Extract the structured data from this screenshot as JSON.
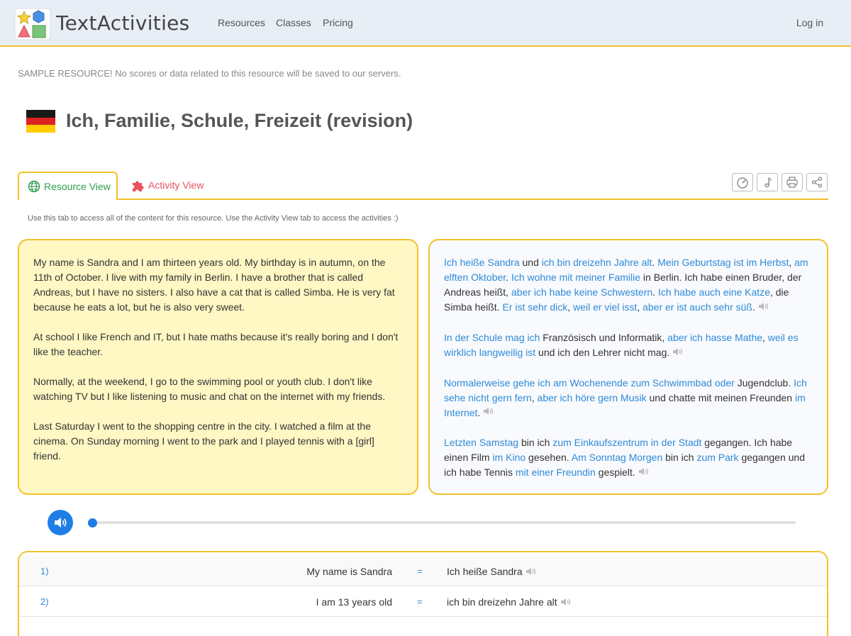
{
  "header": {
    "brand": "TextActivities",
    "nav": [
      "Resources",
      "Classes",
      "Pricing"
    ],
    "login": "Log in"
  },
  "sample_note": "SAMPLE RESOURCE! No scores or data related to this resource will be saved to our servers.",
  "page_title": "Ich, Familie, Schule, Freizeit (revision)",
  "tabs": {
    "resource": "Resource View",
    "activity": "Activity View"
  },
  "hint": "Use this tab to access all of the content for this resource. Use the Activity View tab to access the activities :)",
  "english": [
    "My name is Sandra and I am thirteen years old. My birthday is in autumn, on the 11th of October. I live with my family in Berlin. I have a brother that is called Andreas, but I have no sisters. I also have a cat that is called Simba. He is very fat because he eats a lot, but he is also very sweet.",
    "At school I like French and IT, but I hate maths because it's really boring and I don't like the teacher.",
    "Normally, at the weekend, I go to the swimming pool or youth club. I don't like watching TV but I like listening to music and chat on the internet with my friends.",
    "Last Saturday I went to the shopping centre in the city. I watched a film at the cinema. On Sunday morning I went to the park and I played tennis with a [girl] friend."
  ],
  "german": [
    [
      {
        "t": "Ich heiße Sandra",
        "b": true
      },
      {
        "t": " und ",
        "b": false
      },
      {
        "t": "ich bin dreizehn Jahre alt",
        "b": true
      },
      {
        "t": ". ",
        "b": false
      },
      {
        "t": "Mein Geburtstag ist im Herbst",
        "b": true
      },
      {
        "t": ", ",
        "b": false
      },
      {
        "t": "am elften Oktober",
        "b": true
      },
      {
        "t": ". ",
        "b": false
      },
      {
        "t": "Ich wohne mit meiner Familie",
        "b": true
      },
      {
        "t": " in Berlin. Ich habe einen Bruder, der Andreas heißt, ",
        "b": false
      },
      {
        "t": "aber ich habe keine Schwestern",
        "b": true
      },
      {
        "t": ". ",
        "b": false
      },
      {
        "t": "Ich habe auch eine Katze",
        "b": true
      },
      {
        "t": ", die Simba heißt. ",
        "b": false
      },
      {
        "t": "Er ist sehr dick",
        "b": true
      },
      {
        "t": ", ",
        "b": false
      },
      {
        "t": "weil er viel isst",
        "b": true
      },
      {
        "t": ", ",
        "b": false
      },
      {
        "t": "aber er ist auch sehr süß",
        "b": true
      },
      {
        "t": ".",
        "b": false
      }
    ],
    [
      {
        "t": "In der Schule mag ich",
        "b": true
      },
      {
        "t": " Französisch und Informatik, ",
        "b": false
      },
      {
        "t": "aber ich hasse Mathe",
        "b": true
      },
      {
        "t": ", ",
        "b": false
      },
      {
        "t": "weil es wirklich langweilig ist",
        "b": true
      },
      {
        "t": " und ich den Lehrer nicht mag.",
        "b": false
      }
    ],
    [
      {
        "t": "Normalerweise gehe ich am Wochenende zum Schwimmbad oder",
        "b": true
      },
      {
        "t": " Jugendclub. ",
        "b": false
      },
      {
        "t": "Ich sehe nicht gern fern",
        "b": true
      },
      {
        "t": ", ",
        "b": false
      },
      {
        "t": "aber ich höre gern Musik",
        "b": true
      },
      {
        "t": " und chatte mit meinen Freunden ",
        "b": false
      },
      {
        "t": "im Internet",
        "b": true
      },
      {
        "t": ".",
        "b": false
      }
    ],
    [
      {
        "t": "Letzten Samstag",
        "b": true
      },
      {
        "t": " bin ich ",
        "b": false
      },
      {
        "t": "zum Einkaufszentrum in der Stadt",
        "b": true
      },
      {
        "t": " gegangen. Ich habe einen Film ",
        "b": false
      },
      {
        "t": "im Kino",
        "b": true
      },
      {
        "t": " gesehen. ",
        "b": false
      },
      {
        "t": "Am Sonntag Morgen",
        "b": true
      },
      {
        "t": " bin ich ",
        "b": false
      },
      {
        "t": "zum Park",
        "b": true
      },
      {
        "t": " gegangen und ich habe Tennis ",
        "b": false
      },
      {
        "t": "mit einer Freundin",
        "b": true
      },
      {
        "t": " gespielt.",
        "b": false
      }
    ]
  ],
  "audio": {
    "progress": 0
  },
  "vocab": [
    {
      "num": "1)",
      "en": "My name is Sandra",
      "eq": "=",
      "de": "Ich heiße Sandra"
    },
    {
      "num": "2)",
      "en": "I am 13 years old",
      "eq": "=",
      "de": "ich bin dreizehn Jahre alt"
    }
  ],
  "colors": {
    "accent": "#f3c12b",
    "link": "#2f8ad8",
    "resource_tab": "#2e9e4f",
    "activity_tab": "#e8525f",
    "english_panel": "#fff7c4",
    "play": "#1e7ee6"
  },
  "icons": {
    "tools": [
      "speedometer-icon",
      "music-note-icon",
      "print-icon",
      "share-icon"
    ]
  }
}
